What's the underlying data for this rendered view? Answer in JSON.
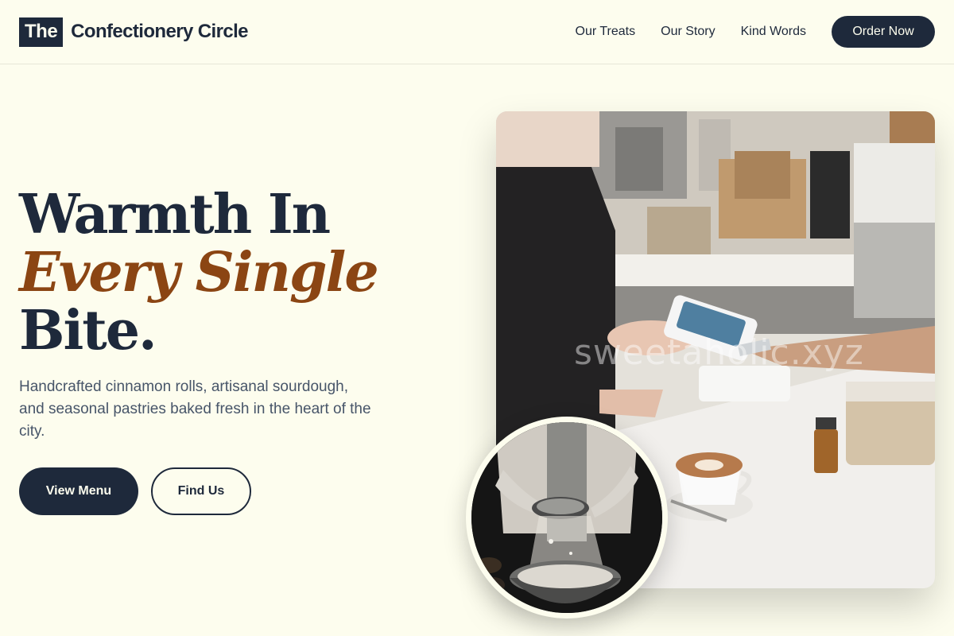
{
  "header": {
    "logo_mark": "The",
    "logo_text": "Confectionery Circle",
    "nav": [
      {
        "label": "Our Treats"
      },
      {
        "label": "Our Story"
      },
      {
        "label": "Kind Words"
      }
    ],
    "cta_label": "Order Now"
  },
  "hero": {
    "title_line1": "Warmth In",
    "title_line2": "Every Single",
    "title_line3": "Bite.",
    "subtitle": "Handcrafted cinnamon rolls, artisanal sourdough, and seasonal pastries baked fresh in the heart of the city.",
    "primary_button": "View Menu",
    "secondary_button": "Find Us"
  },
  "images": {
    "main_watermark": "sweetaholic.xyz"
  },
  "colors": {
    "background": "#fdfdee",
    "primary": "#1e293b",
    "accent": "#8b4513",
    "muted_text": "#475569"
  }
}
